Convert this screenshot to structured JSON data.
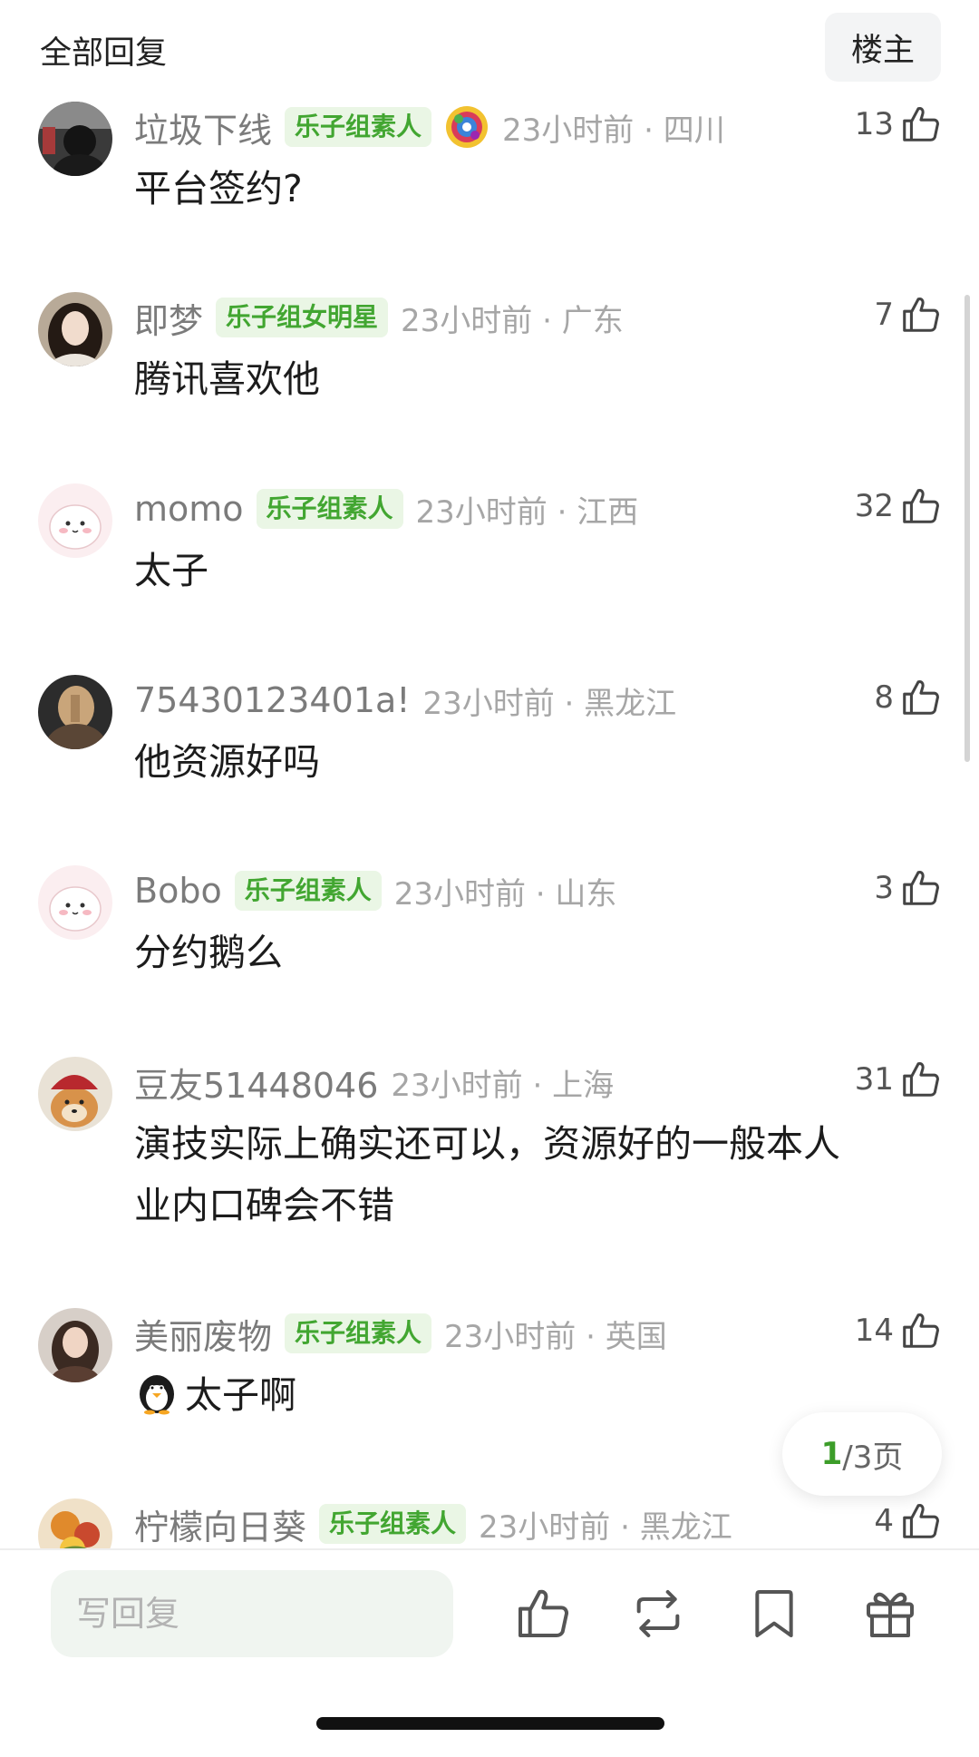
{
  "header": {
    "title": "全部回复",
    "op_button": "楼主"
  },
  "comments": [
    {
      "username": "垃圾下线",
      "badge": "乐子组素人",
      "has_deco": true,
      "time": "23小时前 · 四川",
      "likes": "13",
      "text": "平台签约?",
      "avatar": "dark-photo"
    },
    {
      "username": "即梦",
      "badge": "乐子组女明星",
      "has_deco": false,
      "time": "23小时前 · 广东",
      "likes": "7",
      "text": "腾讯喜欢他",
      "avatar": "woman-portrait"
    },
    {
      "username": "momo",
      "badge": "乐子组素人",
      "has_deco": false,
      "time": "23小时前 · 江西",
      "likes": "32",
      "text": "太子",
      "avatar": "pink-cartoon"
    },
    {
      "username": "75430123401a!",
      "badge": "",
      "has_deco": false,
      "time": "23小时前 · 黑龙江",
      "likes": "8",
      "text": "他资源好吗",
      "avatar": "girl-back"
    },
    {
      "username": "Bobo",
      "badge": "乐子组素人",
      "has_deco": false,
      "time": "23小时前 · 山东",
      "likes": "3",
      "text": "分约鹅么",
      "avatar": "pink-cartoon"
    },
    {
      "username": "豆友51448046",
      "badge": "",
      "has_deco": false,
      "time": "23小时前 · 上海",
      "likes": "31",
      "text_lines": [
        "演技实际上确实还可以，资源好的一般本人",
        "业内口碑会不错"
      ],
      "avatar": "dog-hat"
    },
    {
      "username": "美丽废物",
      "badge": "乐子组素人",
      "has_deco": false,
      "time": "23小时前 · 英国",
      "likes": "14",
      "text": "太子啊",
      "has_emoji": true,
      "avatar": "woman-portrait-2"
    },
    {
      "username": "柠檬向日葵",
      "badge": "乐子组素人",
      "has_deco": false,
      "time": "23小时前 · 黑龙江",
      "likes": "4",
      "text": "",
      "avatar": "colorful-art"
    }
  ],
  "pager": {
    "current": "1",
    "total_label": "/3页"
  },
  "bottom_bar": {
    "reply_placeholder": "写回复"
  },
  "colors": {
    "badge_bg": "#eaf6e5",
    "badge_text": "#42a631",
    "pager_current": "#3c9d29"
  }
}
